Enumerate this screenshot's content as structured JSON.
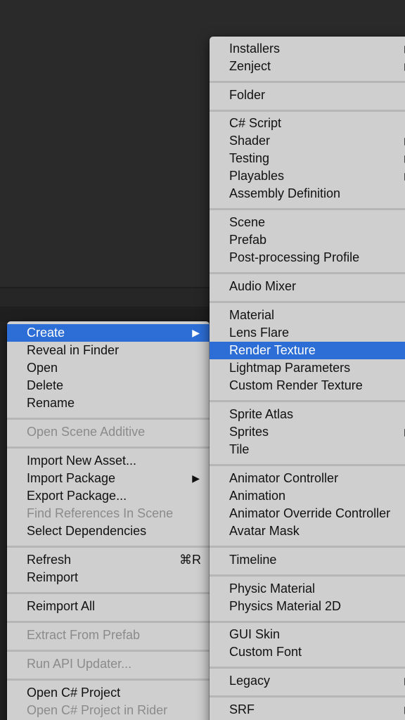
{
  "project_menu": {
    "items": [
      {
        "label": "Create",
        "arrow": "▶",
        "selected": true
      },
      {
        "label": "Reveal in Finder"
      },
      {
        "label": "Open"
      },
      {
        "label": "Delete"
      },
      {
        "label": "Rename"
      },
      {
        "label": "Open Scene Additive",
        "disabled": true
      },
      {
        "label": "Import New Asset..."
      },
      {
        "label": "Import Package",
        "arrow": "▶"
      },
      {
        "label": "Export Package..."
      },
      {
        "label": "Find References In Scene",
        "disabled": true
      },
      {
        "label": "Select Dependencies"
      },
      {
        "label": "Refresh",
        "shortcut": "⌘R"
      },
      {
        "label": "Reimport"
      },
      {
        "label": "Reimport All"
      },
      {
        "label": "Extract From Prefab",
        "disabled": true
      },
      {
        "label": "Run API Updater...",
        "disabled": true
      },
      {
        "label": "Open C# Project"
      },
      {
        "label": "Open C# Project in Rider",
        "disabled": true
      }
    ]
  },
  "create_submenu": {
    "items": [
      {
        "label": "Installers",
        "arrow": "▶"
      },
      {
        "label": "Zenject",
        "arrow": "▶"
      },
      {
        "label": "Folder"
      },
      {
        "label": "C# Script"
      },
      {
        "label": "Shader",
        "arrow": "▶"
      },
      {
        "label": "Testing",
        "arrow": "▶"
      },
      {
        "label": "Playables",
        "arrow": "▶"
      },
      {
        "label": "Assembly Definition"
      },
      {
        "label": "Scene"
      },
      {
        "label": "Prefab"
      },
      {
        "label": "Post-processing Profile"
      },
      {
        "label": "Audio Mixer"
      },
      {
        "label": "Material"
      },
      {
        "label": "Lens Flare"
      },
      {
        "label": "Render Texture",
        "selected": true
      },
      {
        "label": "Lightmap Parameters"
      },
      {
        "label": "Custom Render Texture"
      },
      {
        "label": "Sprite Atlas"
      },
      {
        "label": "Sprites",
        "arrow": "▶"
      },
      {
        "label": "Tile"
      },
      {
        "label": "Animator Controller"
      },
      {
        "label": "Animation"
      },
      {
        "label": "Animator Override Controller"
      },
      {
        "label": "Avatar Mask"
      },
      {
        "label": "Timeline"
      },
      {
        "label": "Physic Material"
      },
      {
        "label": "Physics Material 2D"
      },
      {
        "label": "GUI Skin"
      },
      {
        "label": "Custom Font"
      },
      {
        "label": "Legacy",
        "arrow": "▶"
      },
      {
        "label": "SRF",
        "arrow": "▶"
      }
    ]
  },
  "colors": {
    "menu_bg": "#cfcfcf",
    "selection": "#2d6ed6",
    "text": "#111111",
    "disabled_text": "#8b8b8b"
  }
}
